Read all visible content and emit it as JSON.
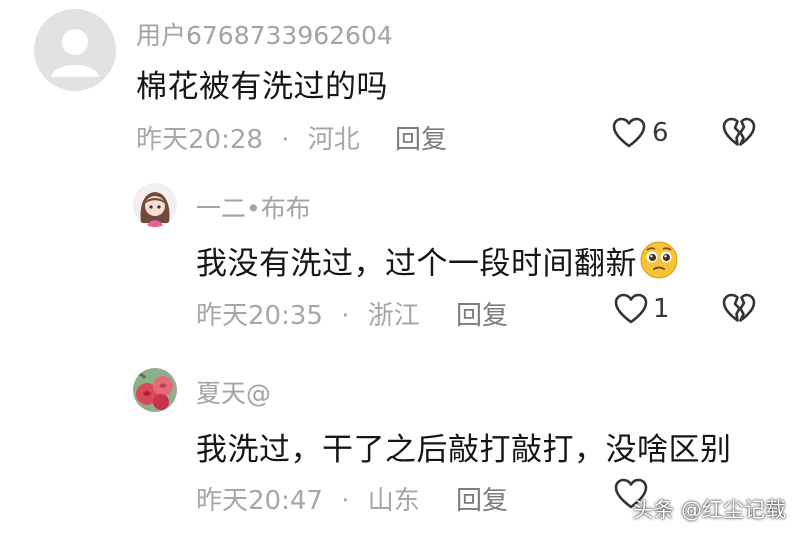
{
  "comments": [
    {
      "username": "用户6768733962604",
      "text": "棉花被有洗过的吗",
      "time": "昨天20:28",
      "separator": "·",
      "location": "河北",
      "reply_label": "回复",
      "likes": "6"
    },
    {
      "username": "一二•布布",
      "text": "我没有洗过，过个一段时间翻新",
      "emoji": "pleading-face",
      "time": "昨天20:35",
      "separator": "·",
      "location": "浙江",
      "reply_label": "回复",
      "likes": "1"
    },
    {
      "username": "夏天@",
      "text": "我洗过，干了之后敲打敲打，没啥区别",
      "time": "昨天20:47",
      "separator": "·",
      "location": "山东",
      "reply_label": "回复",
      "likes": ""
    }
  ],
  "watermark": "头条 @红尘记载",
  "colors": {
    "text": "#161616",
    "muted": "#a7a7a7",
    "reply": "#7c7c7c",
    "icon": "#333333"
  }
}
